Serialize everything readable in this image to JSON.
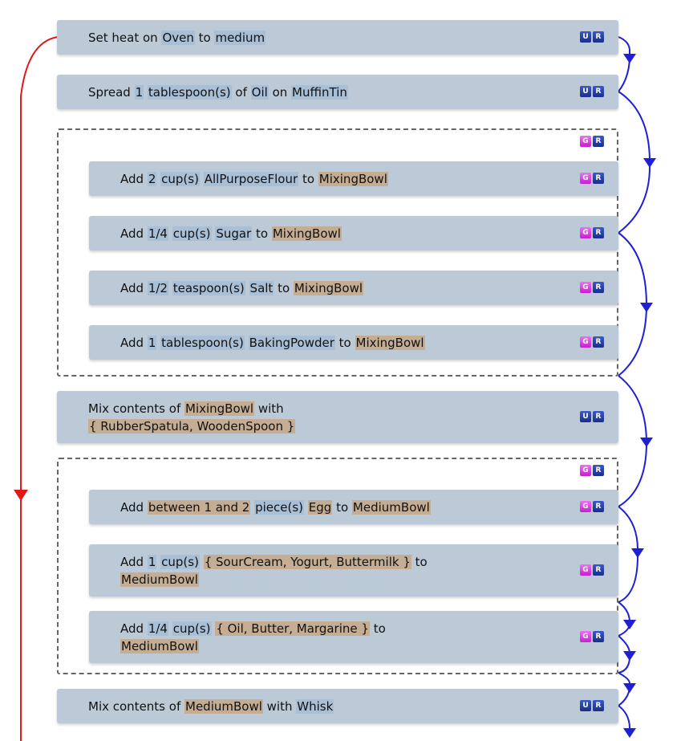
{
  "steps": {
    "s1": {
      "w1": "Set heat on ",
      "oven": "Oven",
      "w2": " to ",
      "medium": "medium"
    },
    "s2": {
      "w1": "Spread ",
      "n": "1",
      "unit": "tablespoon(s)",
      "w2": " of ",
      "oil": "Oil",
      "w3": " on ",
      "tin": "MuffinTin"
    },
    "s3": {
      "w1": "Add ",
      "n": "2",
      "unit": "cup(s)",
      "item": "AllPurposeFlour",
      "w2": " to ",
      "bowl": "MixingBowl"
    },
    "s4": {
      "w1": "Add ",
      "n": "1/4",
      "unit": "cup(s)",
      "item": "Sugar",
      "w2": " to ",
      "bowl": "MixingBowl"
    },
    "s5": {
      "w1": "Add ",
      "n": "1/2",
      "unit": "teaspoon(s)",
      "item": "Salt",
      "w2": " to ",
      "bowl": "MixingBowl"
    },
    "s6": {
      "w1": "Add ",
      "n": "1",
      "unit": "tablespoon(s)",
      "item": "BakingPowder",
      "w2": " to ",
      "bowl": "MixingBowl"
    },
    "s7": {
      "w1": "Mix contents of ",
      "bowl": "MixingBowl",
      "w2": " with",
      "tools": "{ RubberSpatula, WoodenSpoon }"
    },
    "s8": {
      "w1": "Add ",
      "qty": "between 1 and 2",
      "unit": "piece(s)",
      "item": "Egg",
      "w2": " to ",
      "bowl": "MediumBowl"
    },
    "s9": {
      "w1": "Add ",
      "n": "1",
      "unit": "cup(s)",
      "item": "{ SourCream, Yogurt, Buttermilk }",
      "w2": " to",
      "bowl": "MediumBowl"
    },
    "s10": {
      "w1": "Add ",
      "n": "1/4",
      "unit": "cup(s)",
      "item": "{ Oil, Butter, Margarine }",
      "w2": " to",
      "bowl": "MediumBowl"
    },
    "s11": {
      "w1": "Mix contents of ",
      "bowl": "MediumBowl",
      "w2": " with ",
      "tool": "Whisk"
    }
  },
  "buttons": {
    "u": "U",
    "r": "R",
    "g": "G"
  },
  "colors": {
    "step_bg": "#bccad7",
    "blue_highlight": "#a9bfd6",
    "tan_highlight": "#c4ad93",
    "arrow_blue": "#1f1fd8",
    "arrow_red": "#e01a1a",
    "btn_blue": "#2a44b0",
    "btn_magenta": "#d93ae0"
  }
}
